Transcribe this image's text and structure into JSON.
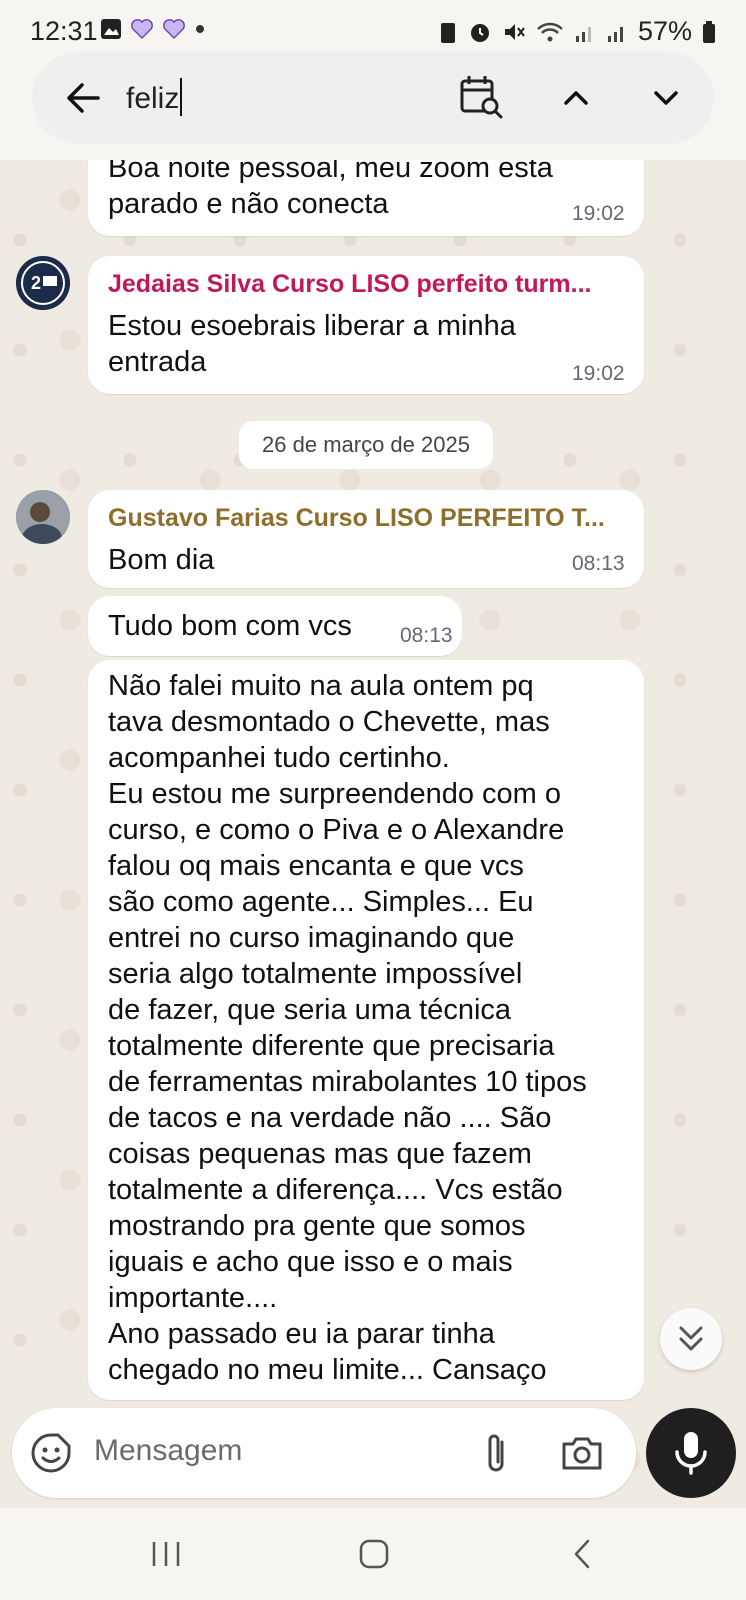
{
  "status_bar": {
    "time": "12:31",
    "battery": "57%"
  },
  "search": {
    "query": "feliz"
  },
  "messages": [
    {
      "id": "m1",
      "text": "Boa noite pessoal,  meu zoom esta\nparado e não conecta",
      "time": "19:02"
    },
    {
      "id": "m2",
      "sender": "Jedaias Silva Curso LISO perfeito turm...",
      "text": "Estou esoebrais liberar a minha\nentrada",
      "time": "19:02"
    },
    {
      "id": "m3",
      "sender": "Gustavo Farias Curso LISO PERFEITO T...",
      "text": "Bom dia",
      "time": "08:13"
    },
    {
      "id": "m4",
      "text": "Tudo bom com vcs",
      "time": "08:13"
    },
    {
      "id": "m5",
      "text": "Não falei muito na aula ontem pq\ntava desmontado o Chevette, mas\nacompanhei tudo certinho.\nEu estou me surpreendendo com o\ncurso, e como o Piva e o Alexandre\nfalou oq mais encanta e que vcs\nsão como agente... Simples... Eu\nentrei no curso imaginando que\nseria algo totalmente impossível\nde fazer, que seria uma técnica\ntotalmente diferente que precisaria\nde ferramentas mirabolantes 10 tipos\nde tacos e na verdade não .... São\ncoisas pequenas mas que fazem\ntotalmente a diferença.... Vcs estão\nmostrando pra gente que somos\niguais e acho que isso e o mais\nimportante....\n Ano passado eu ia parar tinha\nchegado no meu limite... Cansaço"
    }
  ],
  "date_separator": "26 de março de 2025",
  "composer": {
    "placeholder": "Mensagem"
  },
  "colors": {
    "sender_jedaias": "#c2185b",
    "sender_gustavo": "#8d6e2b"
  },
  "icons": [
    "back-arrow-icon",
    "calendar-search-icon",
    "chevron-up-icon",
    "chevron-down-icon",
    "emoji-icon",
    "attach-icon",
    "camera-icon",
    "mic-icon",
    "double-chevron-down-icon"
  ]
}
